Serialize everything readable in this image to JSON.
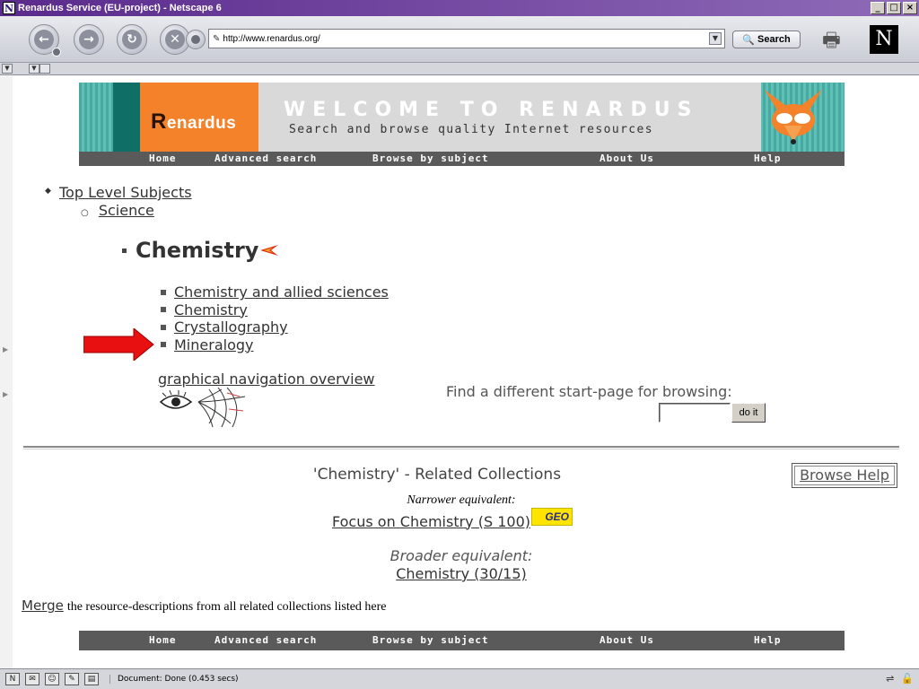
{
  "window": {
    "title": "Renardus Service (EU-project) - Netscape 6",
    "app_icon": "N"
  },
  "toolbar": {
    "url": "http://www.renardus.org/",
    "search_label": "Search",
    "netscape_logo": "N"
  },
  "banner": {
    "logo_cap": "R",
    "logo_rest": "enardus",
    "welcome": "WELCOME TO RENARDUS",
    "tagline": "Search and browse quality Internet resources",
    "menu": [
      "Home",
      "Advanced search",
      "Browse by subject",
      "About Us",
      "Help"
    ]
  },
  "breadcrumb": {
    "top": "Top Level Subjects",
    "science": "Science"
  },
  "heading": "Chemistry",
  "subjects": [
    "Chemistry and allied sciences",
    "Chemistry",
    "Crystallography",
    "Mineralogy"
  ],
  "graph_link": "graphical navigation overview",
  "find": {
    "label": "Find a different start-page for browsing:",
    "value": "",
    "button": "do it"
  },
  "related": {
    "title": "'Chemistry' - Related Collections",
    "browse_help": "Browse Help",
    "narrower_label": "Narrower equivalent:",
    "narrower_link": "Focus on Chemistry (S 100)",
    "geo_badge": "GEO",
    "broader_label": "Broader equivalent:",
    "broader_link": "Chemistry (30/15)"
  },
  "merge": {
    "link": "Merge",
    "text": "the resource-descriptions from all related collections listed here"
  },
  "footer_menu": [
    "Home",
    "Advanced search",
    "Browse by subject",
    "About Us",
    "Help"
  ],
  "status": {
    "text": "Document: Done (0.453 secs)"
  },
  "colors": {
    "banner_orange": "#f4822a",
    "banner_teal": "#5ec0b6",
    "menu_bar": "#5a5a5a",
    "arrow_red": "#e81010"
  }
}
